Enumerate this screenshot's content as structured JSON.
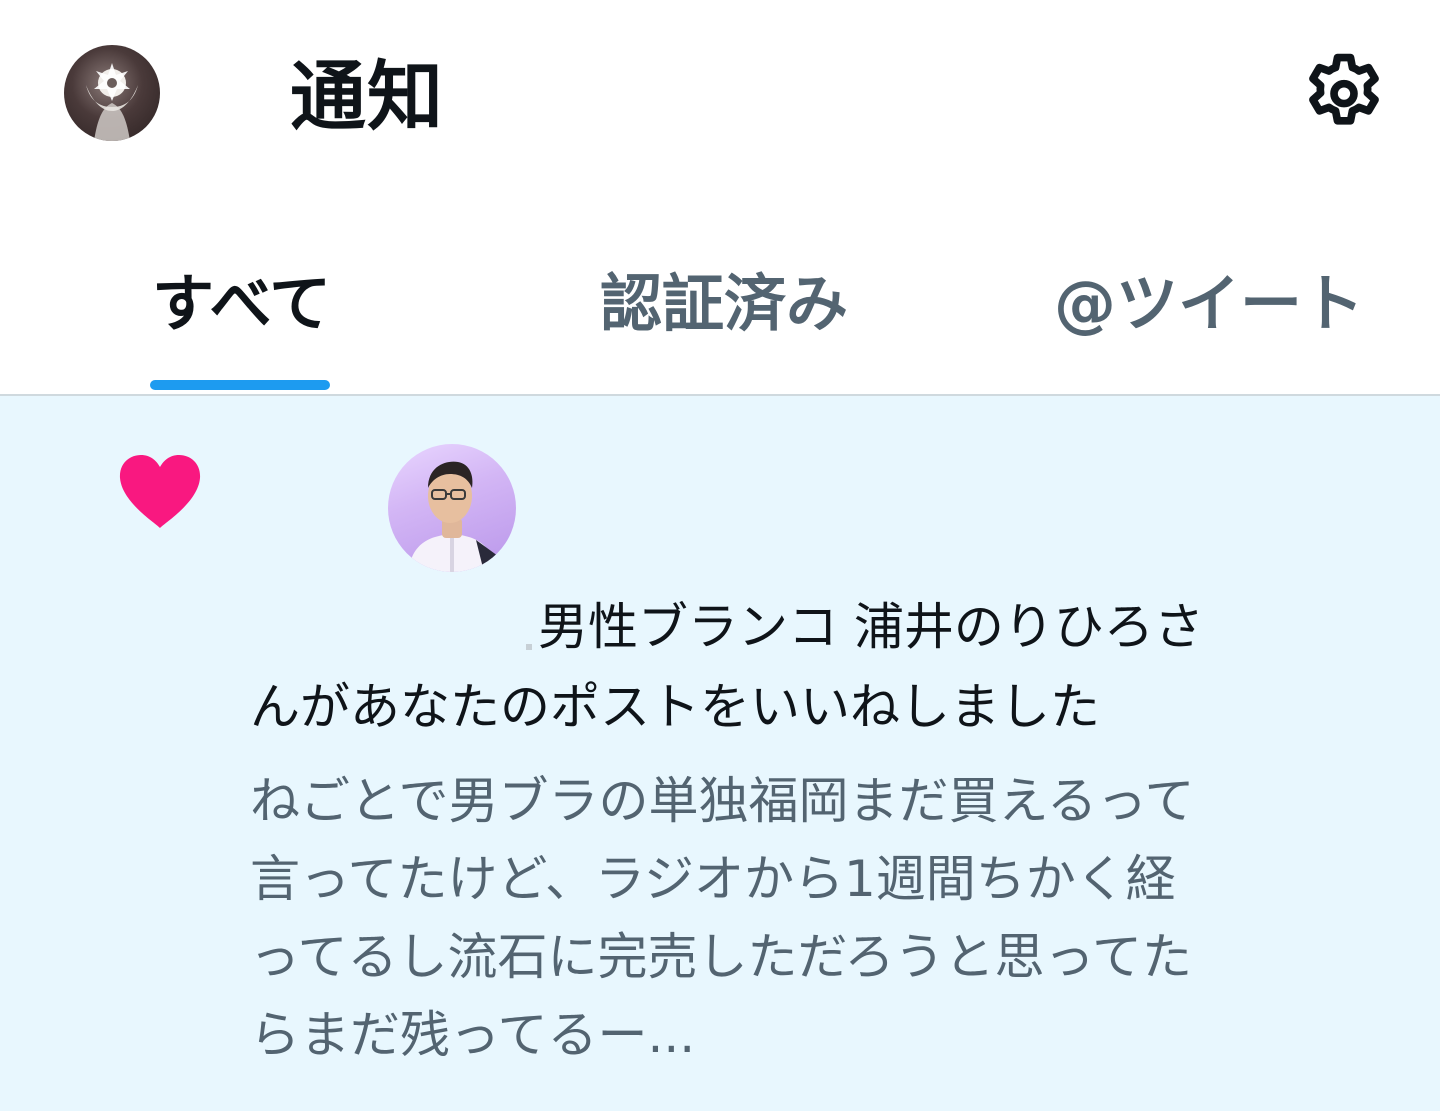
{
  "header": {
    "title": "通知"
  },
  "tabs": [
    {
      "label": "すべて",
      "selected": true
    },
    {
      "label": "認証済み",
      "selected": false
    },
    {
      "label": "@ツイート",
      "selected": false
    }
  ],
  "notification": {
    "type_icon": "heart-icon",
    "liker_name": "男性ブランコ 浦井のりひろさ",
    "action_text": "んがあなたのポストをいいねしました",
    "post_preview_lines": [
      "ねごとで男ブラの単独福岡まだ買えるって",
      "言ってたけど、ラジオから1週間ちかく経",
      "ってるし流石に完売しただろうと思ってた",
      "らまだ残ってるー..."
    ]
  },
  "colors": {
    "accent": "#1d9bf0",
    "like": "#f91880",
    "unread_background": "#e8f7fe",
    "primary_text": "#0f1419",
    "secondary_text": "#536471"
  }
}
